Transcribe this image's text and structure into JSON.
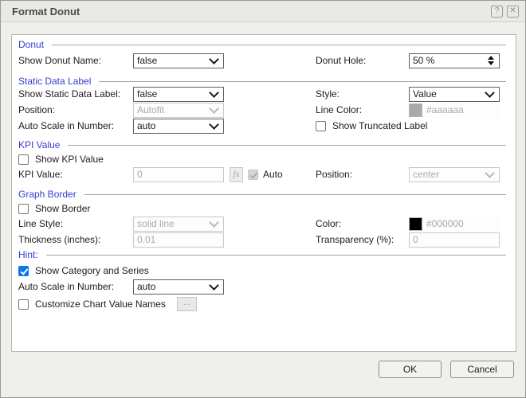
{
  "window": {
    "title": "Format Donut",
    "help_icon": "?",
    "close_icon": "✕"
  },
  "colors": {
    "accent_blue": "#3b3bd1",
    "checked_checkbox_blue": "#0b76ee",
    "line_color_swatch": "#aaaaaa",
    "border_color_swatch": "#000000"
  },
  "sections": {
    "donut": {
      "title": "Donut",
      "show_donut_name": {
        "label": "Show Donut Name:",
        "value": "false"
      },
      "donut_hole": {
        "label": "Donut Hole:",
        "value": "50 %"
      }
    },
    "static_data_label": {
      "title": "Static Data Label",
      "show_static_data_label": {
        "label": "Show Static Data Label:",
        "value": "false"
      },
      "style": {
        "label": "Style:",
        "value": "Value"
      },
      "position": {
        "label": "Position:",
        "value": "Autofit",
        "disabled": true
      },
      "line_color": {
        "label": "Line Color:",
        "value": "#aaaaaa",
        "disabled": true
      },
      "auto_scale_in_number": {
        "label": "Auto Scale in Number:",
        "value": "auto"
      },
      "show_truncated_label": {
        "label": "Show Truncated Label",
        "checked": false
      }
    },
    "kpi_value": {
      "title": "KPI Value",
      "show_kpi_value": {
        "label": "Show KPI Value",
        "checked": false
      },
      "kpi_value": {
        "label": "KPI Value:",
        "value": "0",
        "disabled": true
      },
      "fx_button": "fx",
      "auto": {
        "label": "Auto",
        "checked": true,
        "disabled": true
      },
      "position": {
        "label": "Position:",
        "value": "center",
        "disabled": true
      }
    },
    "graph_border": {
      "title": "Graph Border",
      "show_border": {
        "label": "Show Border",
        "checked": false
      },
      "line_style": {
        "label": "Line Style:",
        "value": "solid line",
        "disabled": true
      },
      "color": {
        "label": "Color:",
        "value": "#000000",
        "disabled": true
      },
      "thickness": {
        "label": "Thickness (inches):",
        "value": "0.01",
        "disabled": true
      },
      "transparency": {
        "label": "Transparency (%):",
        "value": "0",
        "disabled": true
      }
    },
    "hint": {
      "title": "Hint:",
      "show_category_and_series": {
        "label": "Show Category and Series",
        "checked": true
      },
      "auto_scale_in_number": {
        "label": "Auto Scale in Number:",
        "value": "auto"
      },
      "customize_chart_value_names": {
        "label": "Customize Chart Value Names",
        "checked": false
      },
      "ellipsis_button": "..."
    }
  },
  "footer": {
    "ok_label": "OK",
    "cancel_label": "Cancel"
  }
}
